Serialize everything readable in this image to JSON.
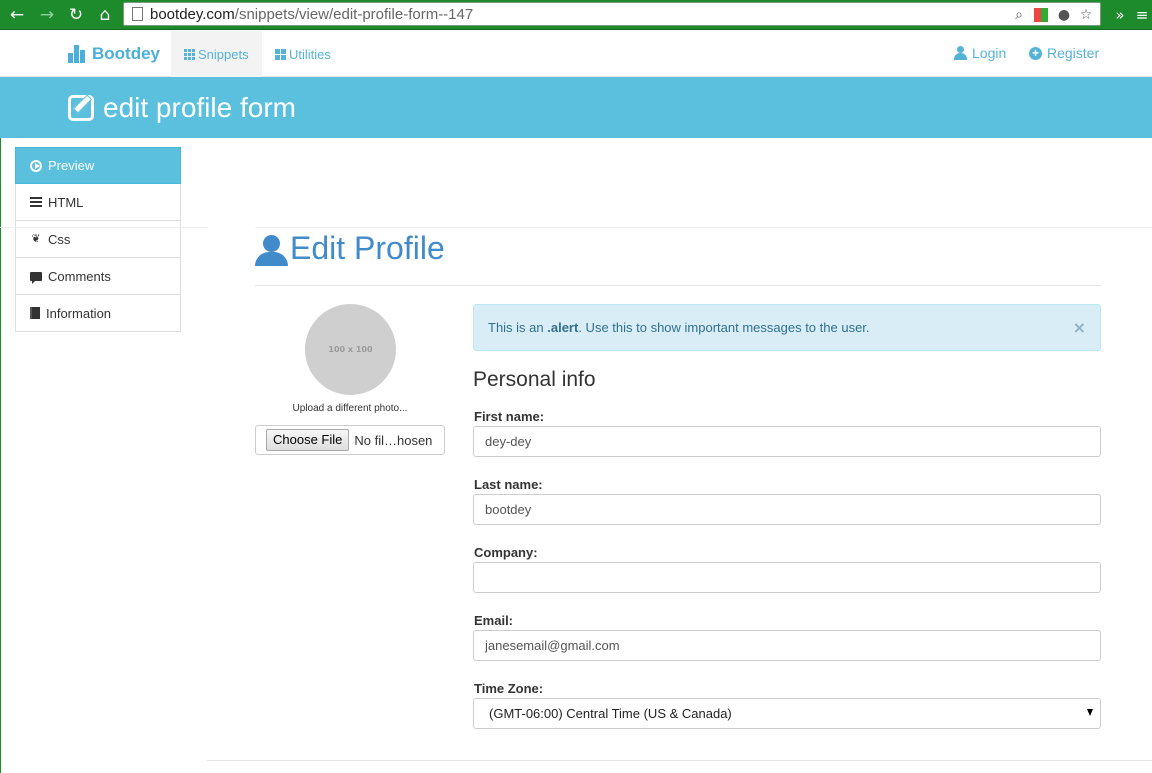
{
  "browser": {
    "url_host": "bootdey.com",
    "url_path": "/snippets/view/edit-profile-form--147"
  },
  "sitenav": {
    "brand": "Bootdey",
    "tabs": [
      {
        "label": "Snippets"
      },
      {
        "label": "Utilities"
      }
    ],
    "login": "Login",
    "register": "Register"
  },
  "band": {
    "title": "edit profile form"
  },
  "sidebar": {
    "items": [
      {
        "label": "Preview",
        "active": true
      },
      {
        "label": "HTML"
      },
      {
        "label": "Css"
      },
      {
        "label": "Comments"
      },
      {
        "label": "Information"
      }
    ]
  },
  "main": {
    "heading": "Edit Profile",
    "avatar_text": "100 x 100",
    "upload_caption": "Upload a different photo...",
    "file_button": "Choose File",
    "file_status": "No fil…hosen",
    "alert": {
      "prefix": "This is an ",
      "bold": ".alert",
      "suffix": ". Use this to show important messages to the user.",
      "close": "×"
    },
    "section_title": "Personal info",
    "fields": {
      "first_name": {
        "label": "First name:",
        "value": "dey-dey"
      },
      "last_name": {
        "label": "Last name:",
        "value": "bootdey"
      },
      "company": {
        "label": "Company:",
        "value": ""
      },
      "email": {
        "label": "Email:",
        "value": "janesemail@gmail.com"
      },
      "timezone": {
        "label": "Time Zone:",
        "value": "(GMT-06:00) Central Time (US & Canada)"
      }
    }
  },
  "colors": {
    "chrome_green": "#1d8a2c",
    "accent_blue": "#5bc0de",
    "link_blue": "#428bca"
  }
}
